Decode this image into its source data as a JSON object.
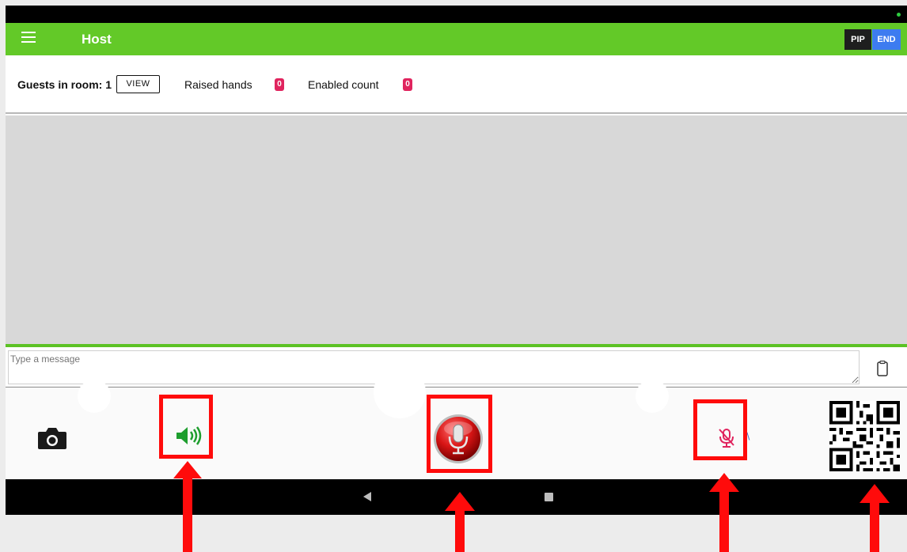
{
  "app_bar": {
    "title": "Host",
    "pip_label": "PIP",
    "end_label": "END"
  },
  "info_bar": {
    "guests_label": "Guests in room: 1",
    "view_label": "VIEW",
    "raised_hands_label": "Raised hands",
    "raised_hands_count": "0",
    "enabled_count_label": "Enabled count",
    "enabled_count": "0"
  },
  "message": {
    "placeholder": "Type a message"
  },
  "bottom_controls": {
    "icons": [
      "camera-icon",
      "speaker-icon",
      "microphone-icon",
      "mic-off-icon",
      "qr-code"
    ]
  },
  "colors": {
    "app_bar": "#63c928",
    "end_button": "#3d7cf0",
    "badge": "#e0245e",
    "highlight": "#ff0b0b"
  }
}
